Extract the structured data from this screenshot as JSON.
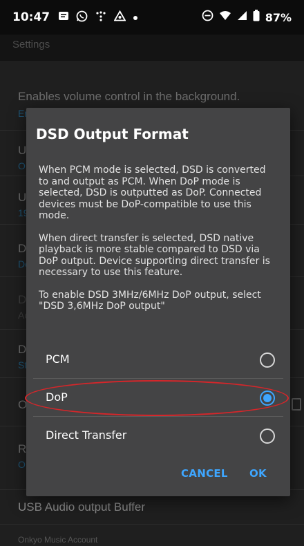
{
  "status_bar": {
    "time": "10:47",
    "battery": "87%"
  },
  "app_bar": {
    "title": "Settings"
  },
  "background_settings": [
    {
      "title": "Enables volume control in the background.",
      "value": "Er"
    },
    {
      "title": "U",
      "value": "O"
    },
    {
      "title": "U",
      "value": "19"
    },
    {
      "title": "D",
      "value": "Do"
    },
    {
      "title": "D",
      "value": "Ac"
    },
    {
      "title": "D",
      "value": "St"
    },
    {
      "title": "O",
      "value": ""
    },
    {
      "title": "Re",
      "value": "O"
    },
    {
      "title": "USB Audio output Buffer",
      "value": ""
    }
  ],
  "section_header": "Onkyo Music Account",
  "dialog": {
    "title": "DSD Output Format",
    "message": [
      "When PCM mode is selected, DSD is converted to and output as PCM. When DoP mode is selected, DSD is outputted as DoP. Connected devices must be DoP-compatible to use this mode.",
      "When direct transfer is selected, DSD native playback is more stable compared to DSD via DoP output. Device supporting direct transfer is necessary to use this feature.",
      "To enable DSD 3MHz/6MHz DoP output, select \"DSD 3,6MHz DoP output\""
    ],
    "options": [
      {
        "label": "PCM",
        "selected": false
      },
      {
        "label": "DoP",
        "selected": true
      },
      {
        "label": "Direct Transfer",
        "selected": false
      }
    ],
    "cancel_label": "CANCEL",
    "ok_label": "OK"
  },
  "colors": {
    "accent": "#3ea6ff",
    "dialog_bg": "#444445",
    "annotation": "#d6262a"
  }
}
